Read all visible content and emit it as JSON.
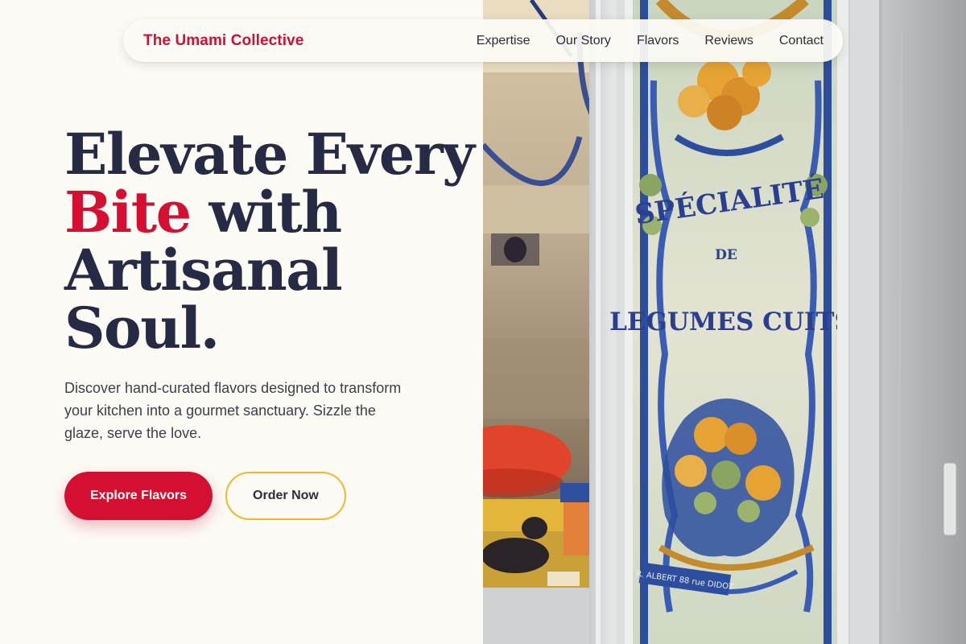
{
  "brand": {
    "name": "The Umami Collective"
  },
  "nav": {
    "links": [
      "Expertise",
      "Our Story",
      "Flavors",
      "Reviews",
      "Contact"
    ]
  },
  "hero": {
    "headline": {
      "line1": "Elevate Every",
      "accent_word": "Bite",
      "line2_rest": " with",
      "line3": "Artisanal",
      "line4": "Soul."
    },
    "subtitle": "Discover hand-curated flavors designed to transform your kitchen into a gourmet sanctuary. Sizzle the glaze, serve the love.",
    "primary_cta": "Explore Flavors",
    "secondary_cta": "Order Now"
  },
  "image": {
    "sign_line1": "SPÉCIALITÉ",
    "sign_line2": "DE",
    "sign_line3": "LEGUMES CUITS",
    "sign_credit": "R. ALBERT 88 rue DIDOT"
  },
  "colors": {
    "brand_red": "#d50f32",
    "navy_text": "#272a44",
    "gold_outline": "#f2b82a",
    "page_bg": "#fcfbf5"
  }
}
